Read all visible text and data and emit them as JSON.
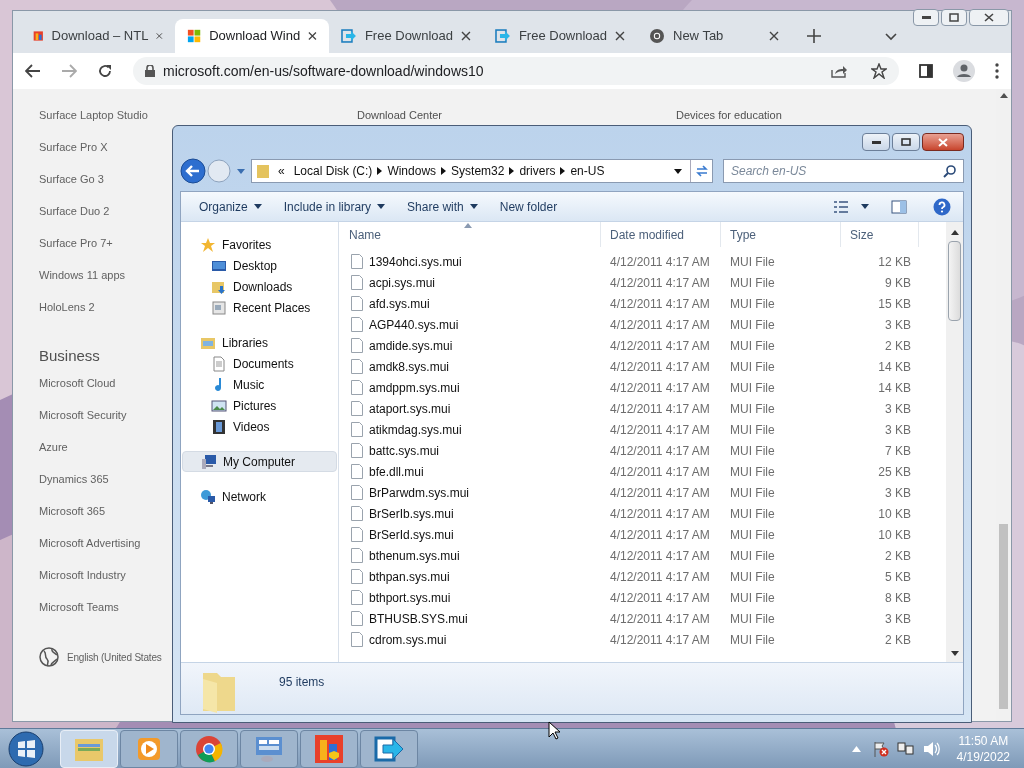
{
  "browser": {
    "tabs": [
      {
        "title": "Download – NTL",
        "kind": "ntlite",
        "selected": false
      },
      {
        "title": "Download Wind",
        "kind": "windows",
        "selected": true
      },
      {
        "title": "Free Download",
        "kind": "arrow",
        "selected": false
      },
      {
        "title": "Free Download",
        "kind": "arrow",
        "selected": false
      },
      {
        "title": "New Tab",
        "kind": "chrome",
        "selected": false
      }
    ],
    "url": "microsoft.com/en-us/software-download/windows10"
  },
  "page": {
    "column_headings": [
      "Download Center",
      "Devices for education"
    ],
    "devices_links": [
      "Surface Laptop Studio",
      "Surface Pro X",
      "Surface Go 3",
      "Surface Duo 2",
      "Surface Pro 7+",
      "Windows 11 apps",
      "HoloLens 2"
    ],
    "business_heading": "Business",
    "business_links": [
      "Microsoft Cloud",
      "Microsoft Security",
      "Azure",
      "Dynamics 365",
      "Microsoft 365",
      "Microsoft Advertising",
      "Microsoft Industry",
      "Microsoft Teams"
    ],
    "language": "English (United States"
  },
  "explorer": {
    "overflow_marker": "«",
    "breadcrumb": [
      "Local Disk (C:)",
      "Windows",
      "System32",
      "drivers",
      "en-US"
    ],
    "search": {
      "placeholder": "Search en-US"
    },
    "toolbar": [
      {
        "label": "Organize",
        "dropdown": true
      },
      {
        "label": "Include in library",
        "dropdown": true
      },
      {
        "label": "Share with",
        "dropdown": true
      },
      {
        "label": "New folder",
        "dropdown": false
      }
    ],
    "nav": [
      {
        "label": "Favorites",
        "kind": "star",
        "selected": false,
        "children": [
          {
            "label": "Desktop",
            "kind": "desktop",
            "selected": false
          },
          {
            "label": "Downloads",
            "kind": "download",
            "selected": false
          },
          {
            "label": "Recent Places",
            "kind": "recent",
            "selected": false
          }
        ]
      },
      {
        "label": "Libraries",
        "kind": "library",
        "selected": false,
        "children": [
          {
            "label": "Documents",
            "kind": "document",
            "selected": false
          },
          {
            "label": "Music",
            "kind": "music",
            "selected": false
          },
          {
            "label": "Pictures",
            "kind": "picture",
            "selected": false
          },
          {
            "label": "Videos",
            "kind": "video",
            "selected": false
          }
        ]
      },
      {
        "label": "My Computer",
        "kind": "computer",
        "selected": true
      },
      {
        "label": "Network",
        "kind": "network",
        "selected": false
      }
    ],
    "columns": [
      "Name",
      "Date modified",
      "Type",
      "Size"
    ],
    "rows": [
      [
        "1394ohci.sys.mui",
        "4/12/2011 4:17 AM",
        "MUI File",
        "12 KB"
      ],
      [
        "acpi.sys.mui",
        "4/12/2011 4:17 AM",
        "MUI File",
        "9 KB"
      ],
      [
        "afd.sys.mui",
        "4/12/2011 4:17 AM",
        "MUI File",
        "15 KB"
      ],
      [
        "AGP440.sys.mui",
        "4/12/2011 4:17 AM",
        "MUI File",
        "3 KB"
      ],
      [
        "amdide.sys.mui",
        "4/12/2011 4:17 AM",
        "MUI File",
        "2 KB"
      ],
      [
        "amdk8.sys.mui",
        "4/12/2011 4:17 AM",
        "MUI File",
        "14 KB"
      ],
      [
        "amdppm.sys.mui",
        "4/12/2011 4:17 AM",
        "MUI File",
        "14 KB"
      ],
      [
        "ataport.sys.mui",
        "4/12/2011 4:17 AM",
        "MUI File",
        "3 KB"
      ],
      [
        "atikmdag.sys.mui",
        "4/12/2011 4:17 AM",
        "MUI File",
        "3 KB"
      ],
      [
        "battc.sys.mui",
        "4/12/2011 4:17 AM",
        "MUI File",
        "7 KB"
      ],
      [
        "bfe.dll.mui",
        "4/12/2011 4:17 AM",
        "MUI File",
        "25 KB"
      ],
      [
        "BrParwdm.sys.mui",
        "4/12/2011 4:17 AM",
        "MUI File",
        "3 KB"
      ],
      [
        "BrSerIb.sys.mui",
        "4/12/2011 4:17 AM",
        "MUI File",
        "10 KB"
      ],
      [
        "BrSerId.sys.mui",
        "4/12/2011 4:17 AM",
        "MUI File",
        "10 KB"
      ],
      [
        "bthenum.sys.mui",
        "4/12/2011 4:17 AM",
        "MUI File",
        "2 KB"
      ],
      [
        "bthpan.sys.mui",
        "4/12/2011 4:17 AM",
        "MUI File",
        "5 KB"
      ],
      [
        "bthport.sys.mui",
        "4/12/2011 4:17 AM",
        "MUI File",
        "8 KB"
      ],
      [
        "BTHUSB.SYS.mui",
        "4/12/2011 4:17 AM",
        "MUI File",
        "3 KB"
      ],
      [
        "cdrom.sys.mui",
        "4/12/2011 4:17 AM",
        "MUI File",
        "2 KB"
      ]
    ],
    "status": "95 items"
  },
  "taskbar": {
    "apps": [
      {
        "kind": "explorer",
        "selected": true
      },
      {
        "kind": "media",
        "selected": false
      },
      {
        "kind": "chrome",
        "selected": false
      },
      {
        "kind": "control",
        "selected": false
      },
      {
        "kind": "ntlite",
        "selected": false
      },
      {
        "kind": "arrow",
        "selected": false
      }
    ],
    "time": "11:50 AM",
    "date": "4/19/2022"
  }
}
